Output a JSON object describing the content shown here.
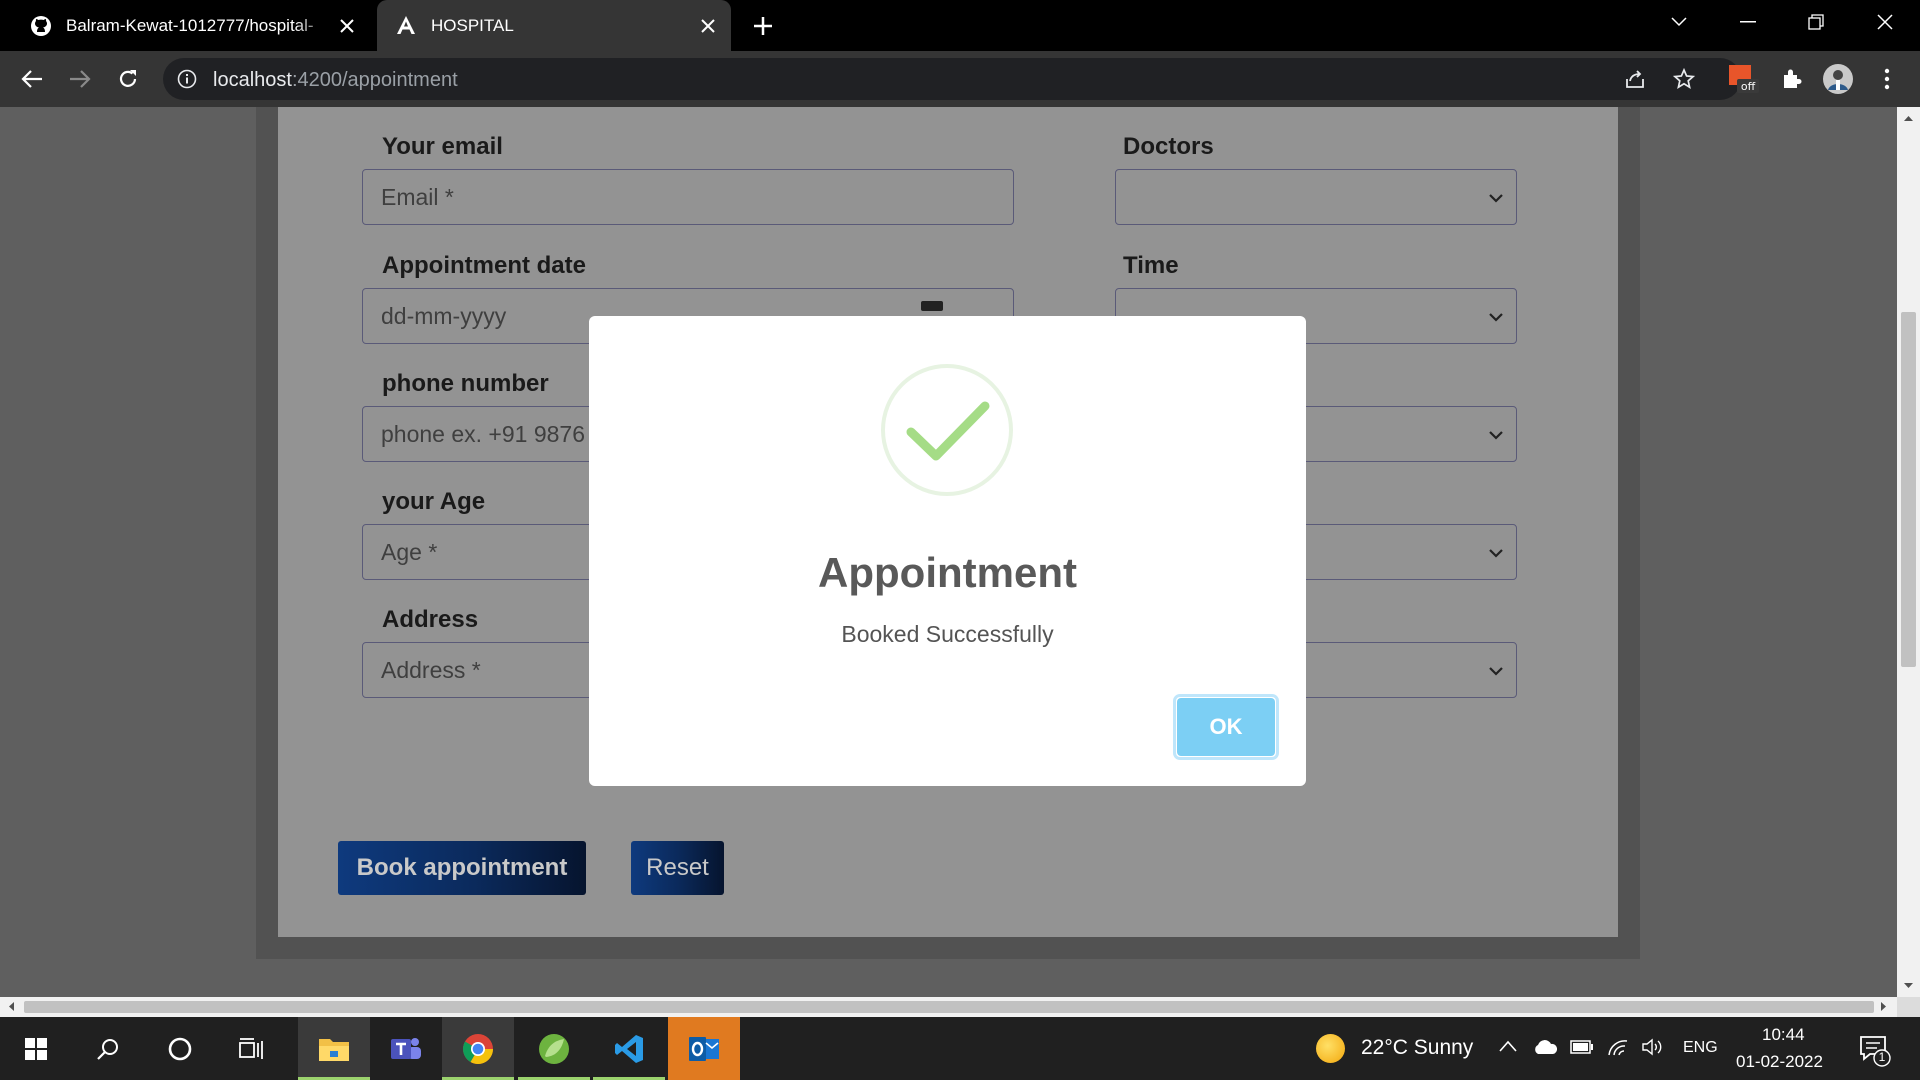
{
  "browser": {
    "tabs": [
      {
        "title": "Balram-Kewat-1012777/hospital-",
        "icon": "github-icon"
      },
      {
        "title": "HOSPITAL",
        "icon": "angular-icon"
      }
    ],
    "url_host": "localhost",
    "url_path": ":4200/appointment",
    "extension_badge": "off"
  },
  "form": {
    "email_label": "Your email",
    "email_placeholder": "Email *",
    "doctors_label": "Doctors",
    "date_label": "Appointment date",
    "date_placeholder": "dd-mm-yyyy",
    "time_label": "Time",
    "phone_label": "phone number",
    "phone_placeholder": "phone ex. +91 9876",
    "age_label": "your Age",
    "age_placeholder": "Age *",
    "address_label": "Address",
    "address_placeholder": "Address *",
    "book_button": "Book appointment",
    "reset_button": "Reset"
  },
  "modal": {
    "title": "Appointment",
    "text": "Booked Successfully",
    "ok_button": "OK",
    "success_color": "#a5dc86",
    "ok_color": "#7ccff4"
  },
  "taskbar": {
    "apps": [
      "windows-start-icon",
      "search-icon",
      "cortana-icon",
      "task-view-icon",
      "file-explorer-icon",
      "teams-icon",
      "chrome-icon",
      "spring-tools-icon",
      "vscode-icon",
      "outlook-icon"
    ],
    "weather": "22°C  Sunny",
    "language": "ENG",
    "time": "10:44",
    "date": "01-02-2022",
    "notifications": "1"
  }
}
